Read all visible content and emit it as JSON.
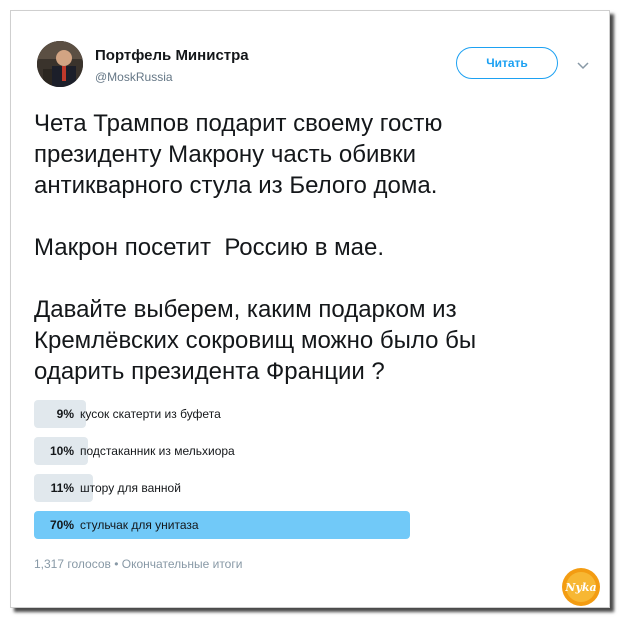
{
  "author": {
    "name": "Портфель Министра",
    "handle": "@MoskRussia"
  },
  "follow_button": {
    "label": "Читать"
  },
  "tweet": {
    "text": "Чета Трампов подарит своему гостю\nпрезиденту Макрону часть обивки\nантикварного стула из Белого дома.\n\nМакрон посетит  Россию в мае.\n\nДавайте выберем, каким подарком из\nКремлёвских сокровищ можно было бы\nодарить президента Франции ?"
  },
  "poll": {
    "options": [
      {
        "percent_label": "9%",
        "percent": 9,
        "label": "кусок скатерти из буфета"
      },
      {
        "percent_label": "10%",
        "percent": 10,
        "label": "подстаканник из мельхиора"
      },
      {
        "percent_label": "11%",
        "percent": 11,
        "label": "штору для ванной"
      },
      {
        "percent_label": "70%",
        "percent": 70,
        "label": "стульчак для унитаза"
      }
    ],
    "votes": "1,317 голосов",
    "separator": "•",
    "status": "Окончательные итоги",
    "winner_color": "#71c9f8",
    "bar_color": "#e1e8ed"
  },
  "watermark": {
    "text": "Nyka"
  },
  "colors": {
    "accent": "#1da1f2",
    "text": "#14171a",
    "muted": "#657786"
  },
  "icons": {
    "chevron": "chevron-down-icon",
    "avatar": "avatar"
  }
}
